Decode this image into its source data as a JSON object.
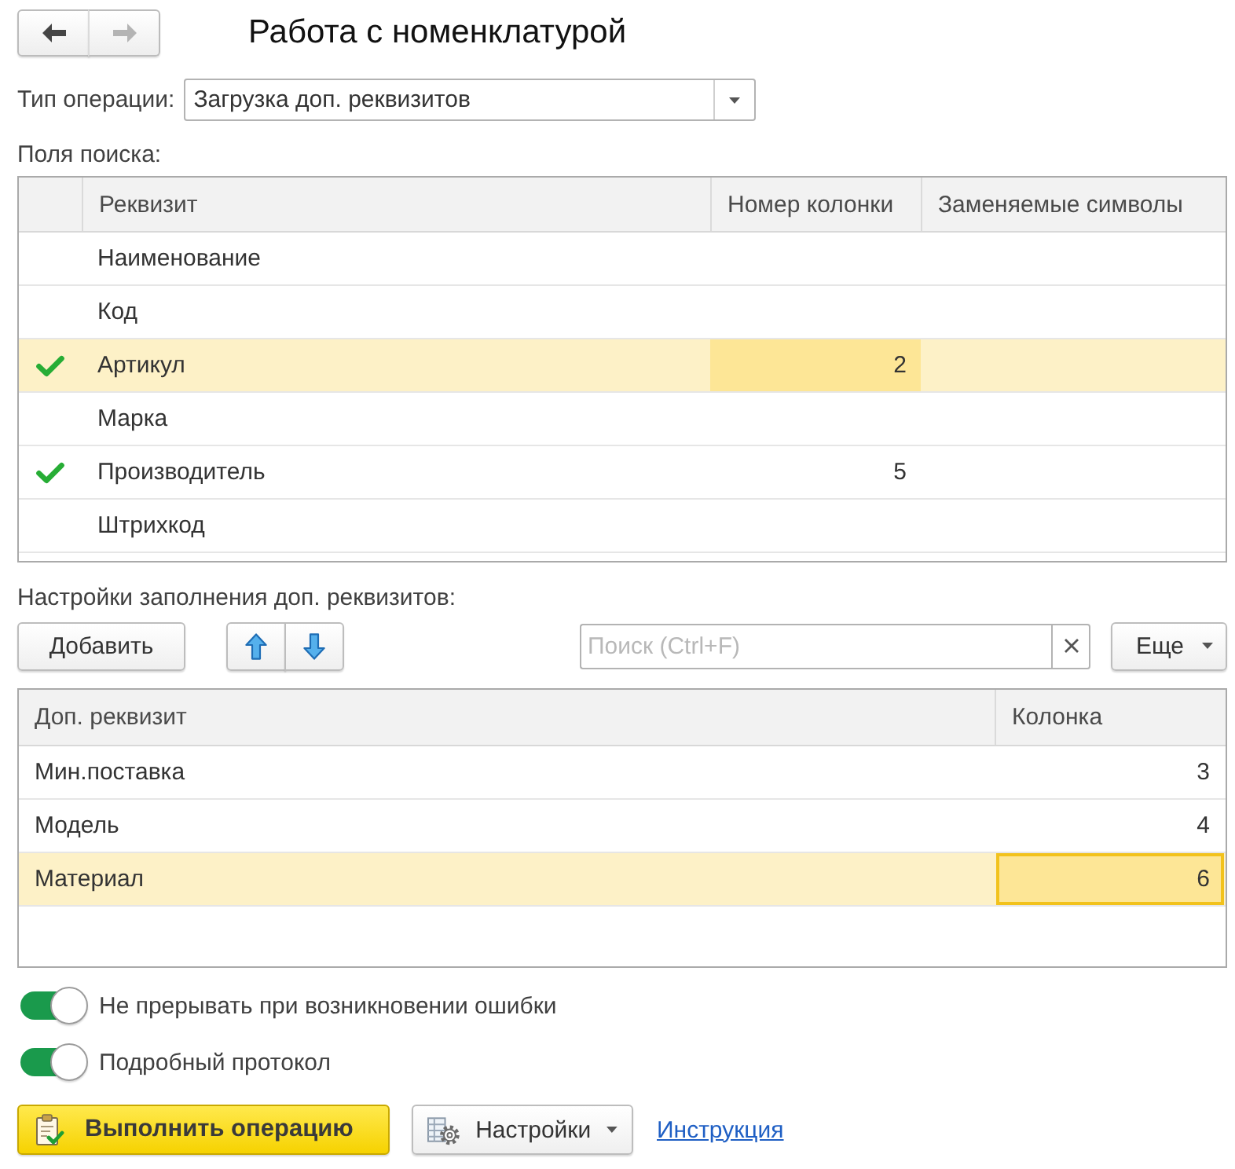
{
  "window": {
    "title": "Работа с номенклатурой"
  },
  "navigation": [
    {
      "kind": "back",
      "disabled": false
    },
    {
      "kind": "forward",
      "disabled": true
    }
  ],
  "operation_type": {
    "label": "Тип операции:",
    "value": "Загрузка доп. реквизитов"
  },
  "search_fields": {
    "label": "Поля поиска:",
    "columns": [
      "Реквизит",
      "Номер колонки",
      "Заменяемые символы"
    ],
    "rows": [
      {
        "checked": false,
        "attribute": "Наименование",
        "selected": false
      },
      {
        "checked": false,
        "attribute": "Код",
        "selected": false
      },
      {
        "checked": true,
        "attribute": "Артикул",
        "column_number": "2",
        "selected": true
      },
      {
        "checked": false,
        "attribute": "Марка",
        "selected": false
      },
      {
        "checked": true,
        "attribute": "Производитель",
        "column_number": "5",
        "selected": false
      },
      {
        "checked": false,
        "attribute": "Штрихкод",
        "selected": false
      }
    ]
  },
  "fill_settings": {
    "label": "Настройки заполнения доп. реквизитов:",
    "add_button": "Добавить",
    "search": {
      "placeholder": "Поиск (Ctrl+F)"
    },
    "more_button": "Еще",
    "columns": [
      "Доп. реквизит",
      "Колонка"
    ],
    "rows": [
      {
        "attribute": "Мин.поставка",
        "column": "3",
        "selected": false
      },
      {
        "attribute": "Модель",
        "column": "4",
        "selected": false
      },
      {
        "attribute": "Материал",
        "column": "6",
        "selected": true
      }
    ]
  },
  "options": [
    {
      "label": "Не прерывать при возникновении ошибки",
      "on": true
    },
    {
      "label": "Подробный протокол",
      "on": true
    }
  ],
  "actions": {
    "execute_button": "Выполнить операцию",
    "settings_button": "Настройки",
    "help_link": "Инструкция"
  }
}
